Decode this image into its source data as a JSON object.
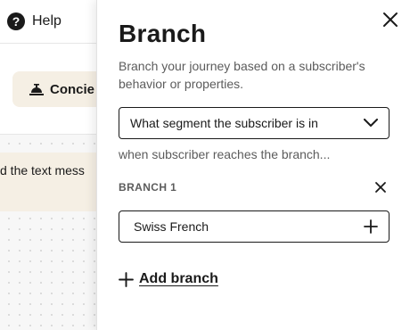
{
  "background": {
    "help_label": "Help",
    "concierge_label": "Concie",
    "node_text": "d the text mess"
  },
  "panel": {
    "title": "Branch",
    "description": "Branch your journey based on a subscriber's behavior or properties.",
    "select_value": "What segment the subscriber is in",
    "reach_label": "when subscriber reaches the branch...",
    "branches": [
      {
        "label": "BRANCH 1",
        "value": "Swiss French"
      }
    ],
    "add_branch_label": "Add branch"
  },
  "icons": {
    "help": "help-circle-icon",
    "concierge": "concierge-bell-icon",
    "close": "close-icon",
    "select": "chevron-down-icon",
    "remove_branch": "close-icon",
    "add_segment": "plus-icon",
    "add_branch": "plus-icon"
  },
  "colors": {
    "text": "#1a1a1a",
    "muted": "#5c5c5c",
    "accent_bg": "#f5efe4",
    "canvas_bg": "#f7f7f7"
  }
}
